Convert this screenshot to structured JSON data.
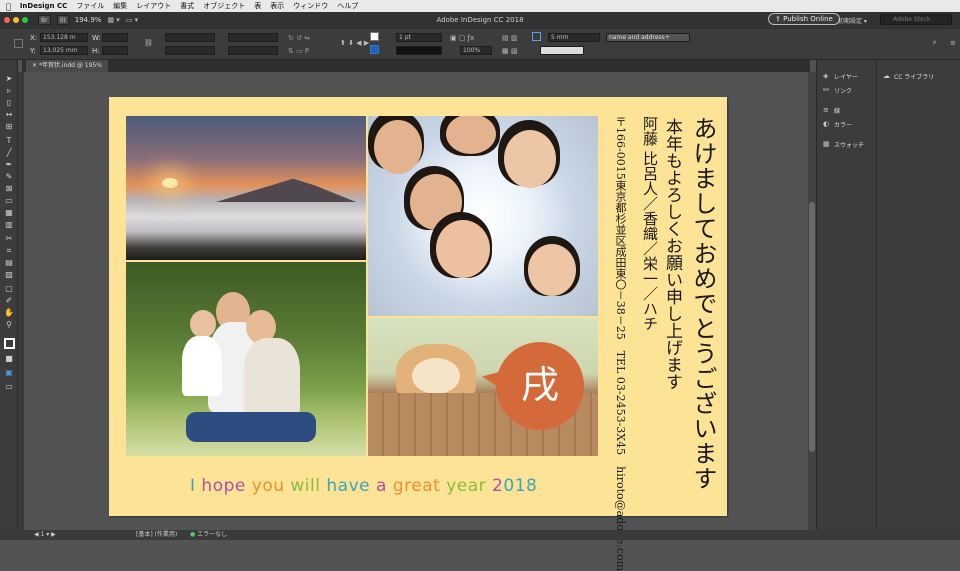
{
  "menubar": {
    "apple": "",
    "app": "InDesign CC",
    "items": [
      "ファイル",
      "編集",
      "レイアウト",
      "書式",
      "オブジェクト",
      "表",
      "表示",
      "ウィンドウ",
      "ヘルプ"
    ]
  },
  "titlebar": {
    "title": "Adobe InDesign CC 2018",
    "zoom": "194.9%",
    "br_label": "Br",
    "st_label": "St",
    "publish_label": "Publish Online",
    "workspace": "初期設定",
    "search_placeholder": "Adobe Stock"
  },
  "control_panel": {
    "x_label": "X:",
    "x_value": "153.128 m",
    "y_label": "Y:",
    "y_value": "13.025 mm",
    "w_label": "W:",
    "h_label": "H:",
    "stroke_weight": "1 pt",
    "opacity": "100%",
    "gutter": "5 mm",
    "object_style": "name and address+"
  },
  "document": {
    "tab_title": "*年賀状.indd @ 195%"
  },
  "panels": {
    "items": [
      "レイヤー",
      "リンク",
      "線",
      "カラー",
      "スウォッチ"
    ],
    "cc_libraries": "CC ライブラリ"
  },
  "statusbar": {
    "page": "1",
    "mode": "[基本] (作業用)",
    "errors": "エラーなし"
  },
  "card": {
    "greeting_main": "あけましておめでとうございます",
    "greeting_sub": "本年もよろしくお願い申し上げます",
    "names": "阿藤 比呂人／香織／栄一／ハチ",
    "postal": "〒166-0015",
    "address": "東京都杉並区成田東〇－38－25",
    "tel": "TEL 03-2453-3X45",
    "email": "hiroto@adobe.com",
    "badge": "戌",
    "slogan_words": [
      {
        "text": "I ",
        "color": "#3aa6b9"
      },
      {
        "text": "hope ",
        "color": "#b44fa0"
      },
      {
        "text": "you ",
        "color": "#e8912d"
      },
      {
        "text": "will ",
        "color": "#8bbd3c"
      },
      {
        "text": "have ",
        "color": "#3aa6b9"
      },
      {
        "text": "a ",
        "color": "#b44fa0"
      },
      {
        "text": "great ",
        "color": "#e8912d"
      },
      {
        "text": "year ",
        "color": "#8bbd3c"
      },
      {
        "text": "2",
        "color": "#b44fa0"
      },
      {
        "text": "018",
        "color": "#3aa6b9"
      }
    ]
  },
  "colors": {
    "card_background": "#fde396",
    "badge": "#d46a3a"
  }
}
